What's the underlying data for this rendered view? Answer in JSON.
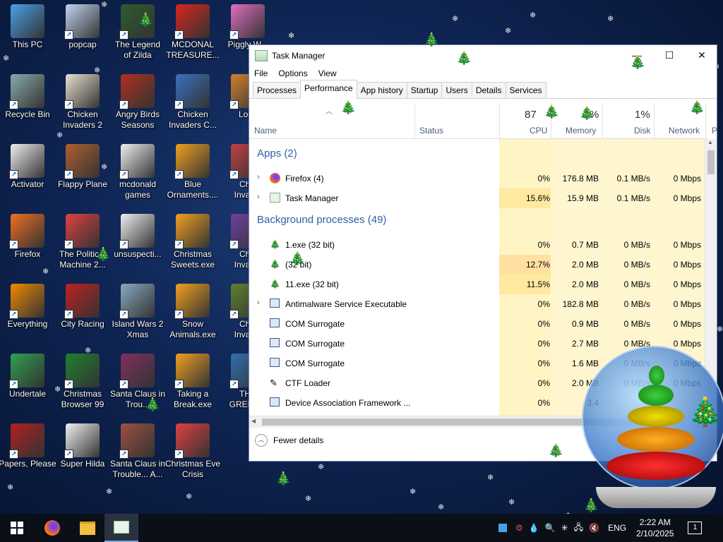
{
  "desktop": {
    "icons": [
      {
        "label": "This PC",
        "color": "#4aa0e6"
      },
      {
        "label": "popcap",
        "color": "#c0d4f0"
      },
      {
        "label": "The Legend\nof Zilda",
        "color": "#2e5c2e"
      },
      {
        "label": "MCDONAL\nTREASURE...",
        "color": "#d8261c"
      },
      {
        "label": "Piggly W...",
        "color": "#e070c0"
      },
      {
        "label": "Recycle Bin",
        "color": "#8aa"
      },
      {
        "label": "Chicken\nInvaders 2",
        "color": "#e8e0d0"
      },
      {
        "label": "Angry Birds\nSeasons",
        "color": "#b03020"
      },
      {
        "label": "Chicken\nInvaders C...",
        "color": "#3a70c0"
      },
      {
        "label": "Loco",
        "color": "#d08030"
      },
      {
        "label": "Activator",
        "color": "#eee"
      },
      {
        "label": "Flappy Plane",
        "color": "#b06030"
      },
      {
        "label": "mcdonald\ngames",
        "color": "#eee"
      },
      {
        "label": "Blue\nOrnaments....",
        "color": "#f0a020"
      },
      {
        "label": "Chic\nInvac...",
        "color": "#c04040"
      },
      {
        "label": "Firefox",
        "color": "#f07020"
      },
      {
        "label": "The Politic...\nMachine 2...",
        "color": "#e04040"
      },
      {
        "label": "unsuspecti...",
        "color": "#eee"
      },
      {
        "label": "Christmas\nSweets.exe",
        "color": "#f0a020"
      },
      {
        "label": "Chic\nInvac...",
        "color": "#7040a0"
      },
      {
        "label": "Everything",
        "color": "#f08a00"
      },
      {
        "label": "City Racing",
        "color": "#c02020"
      },
      {
        "label": "Island Wars 2\nXmas",
        "color": "#8aa8c0"
      },
      {
        "label": "Snow\nAnimals.exe",
        "color": "#f0a020"
      },
      {
        "label": "Chic\nInvac...",
        "color": "#608030"
      },
      {
        "label": "Undertale",
        "color": "#30a050"
      },
      {
        "label": "Christmas\nBrowser 99",
        "color": "#208030"
      },
      {
        "label": "Santa Claus in\nTrou...",
        "color": "#803060"
      },
      {
        "label": "Taking a\nBreak.exe",
        "color": "#f0a020"
      },
      {
        "label": "THE\nGREEN...",
        "color": "#3070b0"
      },
      {
        "label": "Papers, Please",
        "color": "#b02020"
      },
      {
        "label": "Super Hilda",
        "color": "#f0f0f0"
      },
      {
        "label": "Santa Claus in\nTrouble... A...",
        "color": "#a05040"
      },
      {
        "label": "Christmas Eve\nCrisis",
        "color": "#e04040"
      }
    ]
  },
  "window": {
    "title": "Task Manager",
    "minimize": "—",
    "maximize": "☐",
    "close": "✕",
    "menu": [
      "File",
      "Options",
      "View"
    ],
    "tabs": [
      "Processes",
      "Performance",
      "App history",
      "Startup",
      "Users",
      "Details",
      "Services"
    ],
    "active_tab": "Performance",
    "columns": {
      "name": "Name",
      "status": "Status",
      "cpu_pct": "87",
      "cpu": "CPU",
      "mem_pct": "%",
      "mem": "Memory",
      "disk_pct": "1%",
      "disk": "Disk",
      "net": "Network",
      "power": "P"
    },
    "groups": {
      "apps": "Apps (2)",
      "background": "Background processes (49)"
    },
    "rows": [
      {
        "name": "Firefox (4)",
        "cpu": "0%",
        "mem": "176.8 MB",
        "disk": "0.1 MB/s",
        "net": "0 Mbps",
        "expand": true,
        "icon": "firefox-icon"
      },
      {
        "name": "Task Manager",
        "cpu": "15.6%",
        "mem": "15.9 MB",
        "disk": "0.1 MB/s",
        "net": "0 Mbps",
        "expand": true,
        "icon": "taskmanager-icon"
      },
      {
        "name": "1.exe (32 bit)",
        "cpu": "0%",
        "mem": "0.7 MB",
        "disk": "0 MB/s",
        "net": "0 Mbps",
        "expand": false,
        "icon": "tree-icon"
      },
      {
        "name": "(32 bit)",
        "cpu": "12.7%",
        "mem": "2.0 MB",
        "disk": "0 MB/s",
        "net": "0 Mbps",
        "expand": false,
        "icon": "tree-icon"
      },
      {
        "name": "11.exe (32 bit)",
        "cpu": "11.5%",
        "mem": "2.0 MB",
        "disk": "0 MB/s",
        "net": "0 Mbps",
        "expand": false,
        "icon": "tree-icon"
      },
      {
        "name": "Antimalware Service Executable",
        "cpu": "0%",
        "mem": "182.8 MB",
        "disk": "0 MB/s",
        "net": "0 Mbps",
        "expand": true,
        "icon": "service-icon"
      },
      {
        "name": "COM Surrogate",
        "cpu": "0%",
        "mem": "0.9 MB",
        "disk": "0 MB/s",
        "net": "0 Mbps",
        "expand": false,
        "icon": "service-icon"
      },
      {
        "name": "COM Surrogate",
        "cpu": "0%",
        "mem": "2.7 MB",
        "disk": "0 MB/s",
        "net": "0 Mbps",
        "expand": false,
        "icon": "service-icon"
      },
      {
        "name": "COM Surrogate",
        "cpu": "0%",
        "mem": "1.6 MB",
        "disk": "0 MB/s",
        "net": "0 Mbps",
        "expand": false,
        "icon": "service-icon"
      },
      {
        "name": "CTF Loader",
        "cpu": "0%",
        "mem": "2.0 MB",
        "disk": "0 MB/s",
        "net": "0 Mbps",
        "expand": false,
        "icon": "ctf-icon"
      },
      {
        "name": "Device Association Framework ...",
        "cpu": "0%",
        "mem": "3.4",
        "disk": "",
        "net": "",
        "expand": false,
        "icon": "service-icon"
      }
    ],
    "fewer_details": "Fewer details"
  },
  "taskbar": {
    "lang": "ENG",
    "time": "2:22 AM",
    "date": "2/10/2025",
    "notifications": "1"
  },
  "colors": {
    "accent": "#2e5fa3",
    "highlight": "#fff4c4",
    "highlight_strong": "#ffe8a0"
  }
}
